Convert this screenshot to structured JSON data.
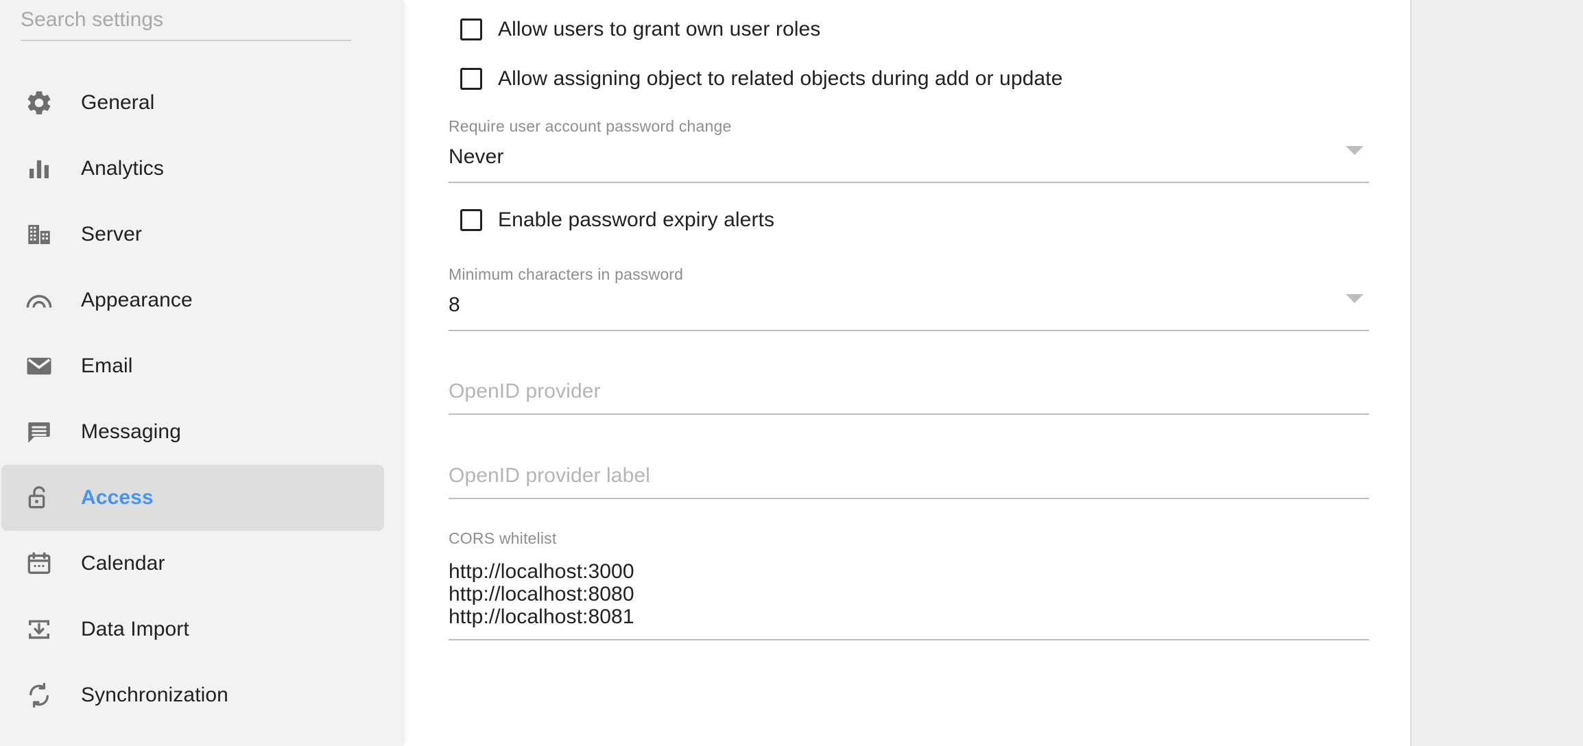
{
  "sidebar": {
    "search": {
      "placeholder": "Search settings",
      "value": ""
    },
    "items": [
      {
        "label": "General",
        "icon": "gear-icon",
        "active": false
      },
      {
        "label": "Analytics",
        "icon": "bar-chart-icon",
        "active": false
      },
      {
        "label": "Server",
        "icon": "building-icon",
        "active": false
      },
      {
        "label": "Appearance",
        "icon": "rainbow-arc-icon",
        "active": false
      },
      {
        "label": "Email",
        "icon": "envelope-icon",
        "active": false
      },
      {
        "label": "Messaging",
        "icon": "chat-bubble-icon",
        "active": false
      },
      {
        "label": "Access",
        "icon": "unlock-icon",
        "active": true
      },
      {
        "label": "Calendar",
        "icon": "calendar-icon",
        "active": false
      },
      {
        "label": "Data Import",
        "icon": "download-box-icon",
        "active": false
      },
      {
        "label": "Synchronization",
        "icon": "sync-refresh-icon",
        "active": false
      }
    ]
  },
  "main": {
    "checkboxes": [
      {
        "label": "Allow users to grant own user roles",
        "checked": false
      },
      {
        "label": "Allow assigning object to related objects during add or update",
        "checked": false
      },
      {
        "label": "Enable password expiry alerts",
        "checked": false
      }
    ],
    "password_change": {
      "label": "Require user account password change",
      "value": "Never",
      "icon": "chevron-down-icon"
    },
    "min_chars": {
      "label": "Minimum characters in password",
      "value": "8",
      "icon": "chevron-down-icon"
    },
    "openid_provider": {
      "placeholder": "OpenID provider",
      "value": ""
    },
    "openid_provider_label": {
      "placeholder": "OpenID provider label",
      "value": ""
    },
    "cors_whitelist": {
      "label": "CORS whitelist",
      "lines": [
        "http://localhost:3000",
        "http://localhost:8080",
        "http://localhost:8081"
      ]
    }
  },
  "colors": {
    "accent": "#4294f7",
    "sidebar_bg": "#f2f2f2",
    "active_item_bg": "#dedede",
    "panel_bg": "#ffffff",
    "page_bg": "#eeeeee",
    "text_primary": "#202124",
    "text_muted": "#8e8e8e",
    "placeholder": "#b5b5b5",
    "underline": "#bdbdbd"
  }
}
